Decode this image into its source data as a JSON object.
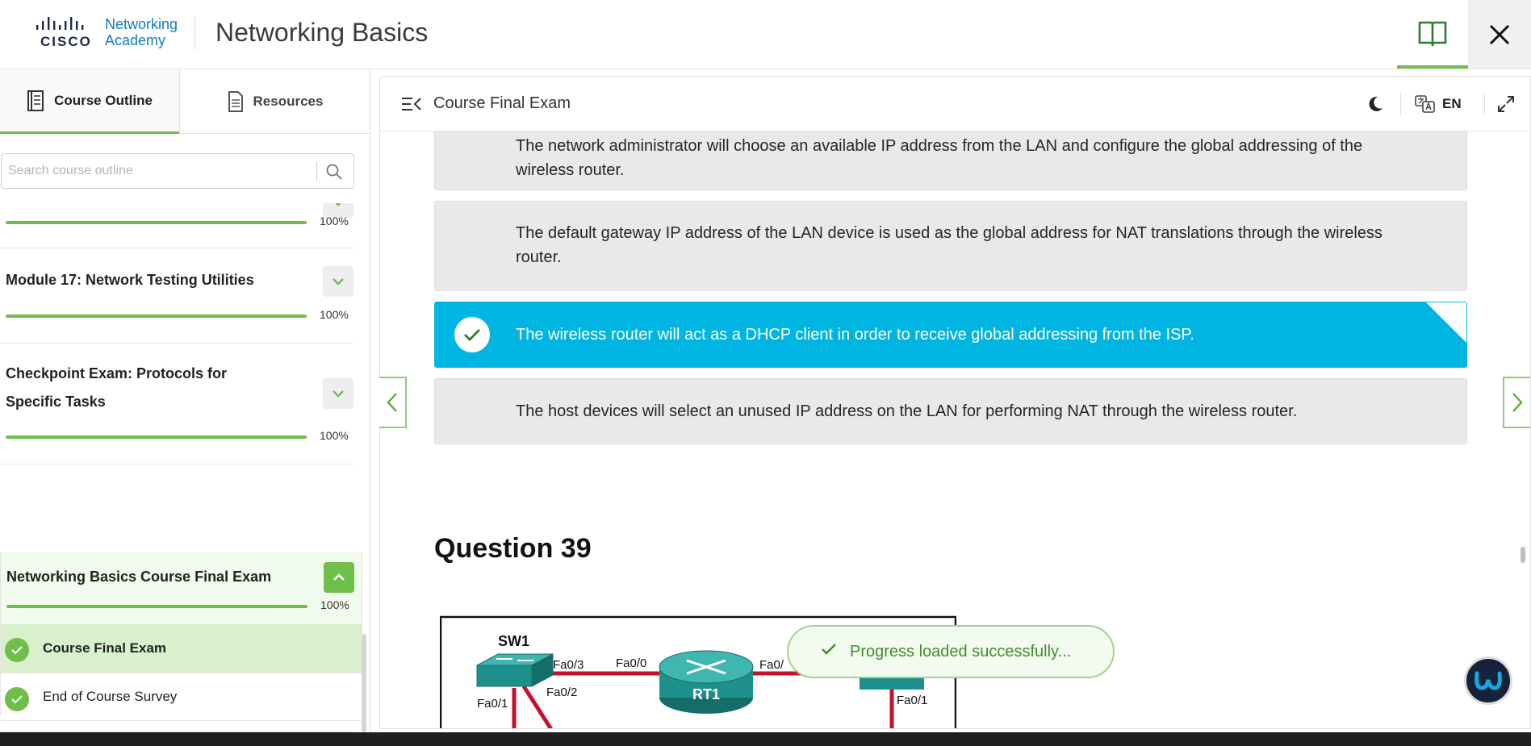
{
  "header": {
    "brand": "CISCO",
    "brand_sub_line1": "Networking",
    "brand_sub_line2": "Academy",
    "title": "Networking Basics"
  },
  "sidebar": {
    "tabs": [
      {
        "label": "Course Outline",
        "icon": "outline-doc-icon",
        "active": true
      },
      {
        "label": "Resources",
        "icon": "document-icon",
        "active": false
      }
    ],
    "search": {
      "placeholder": "Search course outline",
      "value": ""
    },
    "modules": [
      {
        "title": "",
        "progress_label": "100%",
        "progress": 1.0,
        "expanded": false
      },
      {
        "title": "Module 17: Network Testing Utilities",
        "progress_label": "100%",
        "progress": 1.0,
        "expanded": false
      },
      {
        "title_line1": "Checkpoint Exam: Protocols for",
        "title_line2": "Specific Tasks",
        "progress_label": "100%",
        "progress": 1.0,
        "expanded": false
      },
      {
        "title": "Networking Basics Course Final Exam",
        "progress_label": "100%",
        "progress": 1.0,
        "expanded": true
      }
    ],
    "sub_items": [
      {
        "label": "Course Final Exam",
        "completed": true,
        "current": true
      },
      {
        "label": "End of Course Survey",
        "completed": true,
        "current": false
      }
    ]
  },
  "content": {
    "header_title": "Course Final Exam",
    "language": "EN",
    "options": [
      {
        "text": "The network administrator will choose an available IP address from the LAN and configure the global addressing of the wireless router.",
        "selected": false
      },
      {
        "text": "The default gateway IP address of the LAN device is used as the global address for NAT translations through the wireless router.",
        "selected": false
      },
      {
        "text": "The wireless router will act as a DHCP client in order to receive global addressing from the ISP.",
        "selected": true
      },
      {
        "text": "The host devices will select an unused IP address on the LAN for performing NAT through the wireless router.",
        "selected": false
      }
    ],
    "question_label": "Question 39",
    "diagram": {
      "switch_label": "SW1",
      "router_label": "RT1",
      "ports": [
        "Fa0/3",
        "Fa0/0",
        "Fa0/2",
        "Fa0/1",
        "Fa0/",
        "Fa0/1"
      ]
    },
    "toast": "Progress loaded successfully..."
  },
  "colors": {
    "accent_green": "#6ebe4a",
    "selected_blue": "#00b5e2",
    "cisco_blue": "#0d7ec2"
  }
}
